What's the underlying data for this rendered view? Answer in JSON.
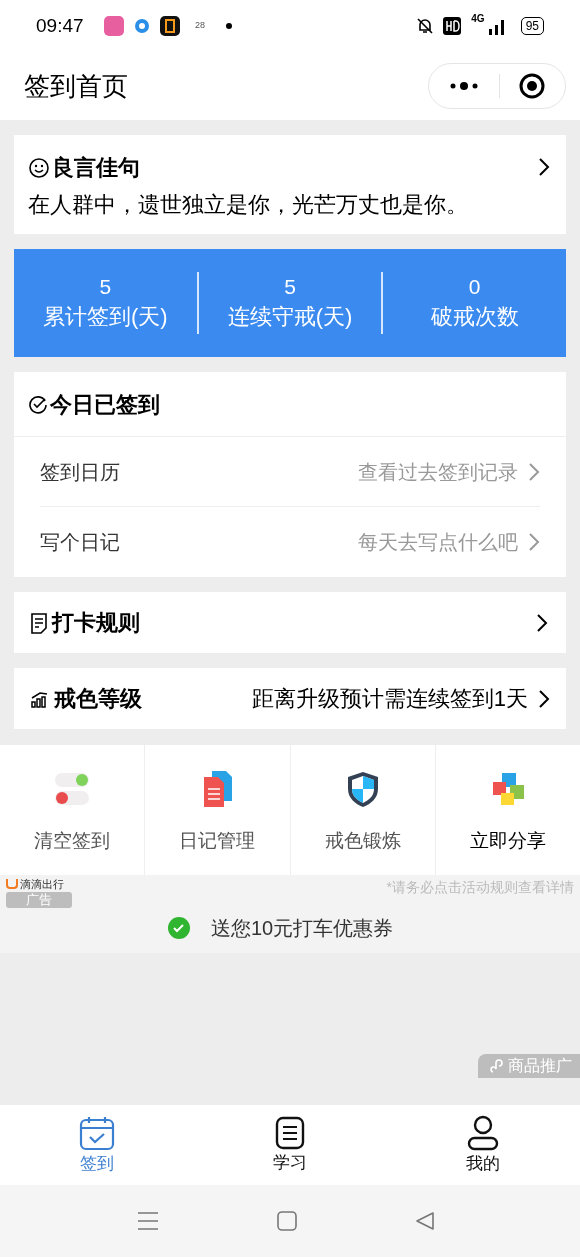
{
  "status_bar": {
    "time": "09:47",
    "calendar_day": "28",
    "battery": "95",
    "network": "4G"
  },
  "header": {
    "title": "签到首页"
  },
  "quote": {
    "title": "良言佳句",
    "text": "在人群中，遗世独立是你，光芒万丈也是你。"
  },
  "stats": [
    {
      "value": "5",
      "label": "累计签到(天)"
    },
    {
      "value": "5",
      "label": "连续守戒(天)"
    },
    {
      "value": "0",
      "label": "破戒次数"
    }
  ],
  "today": {
    "title": "今日已签到",
    "rows": [
      {
        "label": "签到日历",
        "hint": "查看过去签到记录"
      },
      {
        "label": "写个日记",
        "hint": "每天去写点什么吧"
      }
    ]
  },
  "rules": {
    "title": "打卡规则"
  },
  "level": {
    "title": "戒色等级",
    "hint": "距离升级预计需连续签到1天"
  },
  "actions": [
    {
      "kind": "toggles",
      "label": "清空签到"
    },
    {
      "kind": "documents",
      "label": "日记管理"
    },
    {
      "kind": "shield",
      "label": "戒色锻炼"
    },
    {
      "kind": "puzzle",
      "label": "立即分享"
    }
  ],
  "ad": {
    "brand": "滴滴出行",
    "badge": "广告",
    "notice": "*请务必点击活动规则查看详情",
    "offer": "送您10元打车优惠券",
    "promo": "商品推广"
  },
  "tabs": [
    {
      "kind": "calendar",
      "label": "签到",
      "selected": true
    },
    {
      "kind": "notes",
      "label": "学习",
      "selected": false
    },
    {
      "kind": "person",
      "label": "我的",
      "selected": false
    }
  ]
}
